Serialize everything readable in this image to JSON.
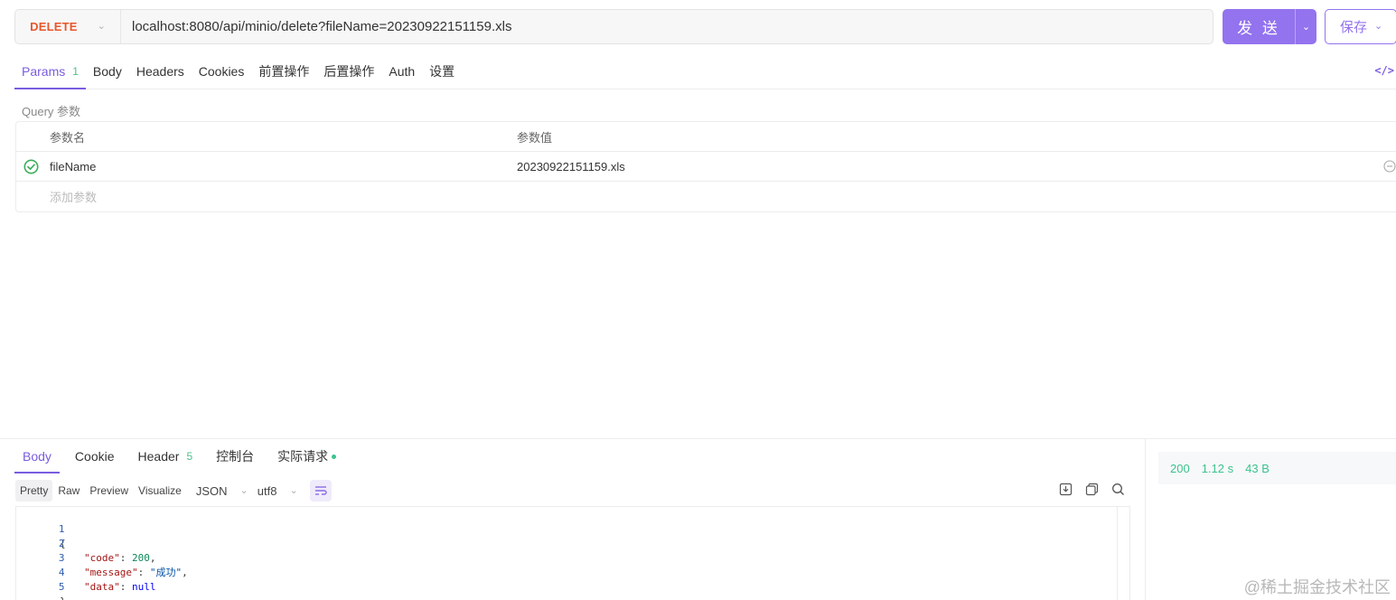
{
  "request": {
    "method": "DELETE",
    "url": "localhost:8080/api/minio/delete?fileName=20230922151159.xls",
    "send_label": "发 送",
    "save_label": "保存"
  },
  "tabs": [
    {
      "label": "Params",
      "count": "1"
    },
    {
      "label": "Body"
    },
    {
      "label": "Headers"
    },
    {
      "label": "Cookies"
    },
    {
      "label": "前置操作"
    },
    {
      "label": "后置操作"
    },
    {
      "label": "Auth"
    },
    {
      "label": "设置"
    }
  ],
  "query": {
    "title": "Query 参数",
    "headers": {
      "name": "参数名",
      "value": "参数值"
    },
    "params": [
      {
        "name": "fileName",
        "value": "20230922151159.xls",
        "enabled": true
      }
    ],
    "add_placeholder": "添加参数"
  },
  "response": {
    "tabs": [
      {
        "label": "Body"
      },
      {
        "label": "Cookie"
      },
      {
        "label": "Header",
        "count": "5"
      },
      {
        "label": "控制台"
      },
      {
        "label": "实际请求"
      }
    ],
    "view_modes": [
      "Pretty",
      "Raw",
      "Preview",
      "Visualize"
    ],
    "format": "JSON",
    "encoding": "utf8",
    "status": {
      "code": "200",
      "time": "1.12 s",
      "size": "43 B"
    },
    "line_numbers": [
      "1",
      "2",
      "3",
      "4",
      "5"
    ],
    "body": {
      "open": "{",
      "code_key": "\"code\"",
      "code_val": "200",
      "message_key": "\"message\"",
      "message_val": "\"成功\"",
      "data_key": "\"data\"",
      "data_val": "null",
      "close": "}"
    }
  },
  "watermark": "@稀土掘金技术社区",
  "colors": {
    "accent": "#9373ee",
    "method_delete": "#e8562a",
    "success": "#3cc28e"
  }
}
